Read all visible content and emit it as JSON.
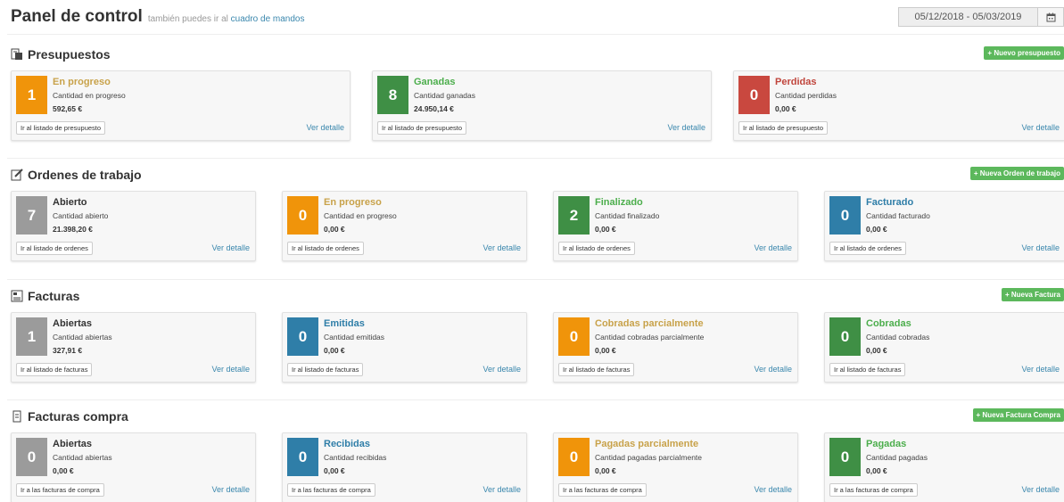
{
  "header": {
    "title": "Panel de control",
    "subtitle": "también puedes ir al",
    "subtitle_link": "cuadro de mandos",
    "date_range": "05/12/2018 - 05/03/2019"
  },
  "colors": {
    "orange": "#f0940a",
    "green": "#3f8f45",
    "red": "#c9483f",
    "gray": "#9b9b9b",
    "blue": "#2f7ea8",
    "title_orange": "#c8a24a",
    "title_green": "#4cae4c",
    "title_red": "#c0453c",
    "title_blue": "#2f7ea8",
    "title_dark": "#333333",
    "button_green": "#5cb85c"
  },
  "sections": [
    {
      "title": "Presupuestos",
      "icon": "quote-icon",
      "new_label": "+ Nuevo presupuesto",
      "cards": [
        {
          "number": "1",
          "title": "En progreso",
          "label": "Cantidad en progreso",
          "amount": "592,65 €",
          "list_label": "Ir al listado de presupuesto",
          "detail_label": "Ver detalle"
        },
        {
          "number": "8",
          "title": "Ganadas",
          "label": "Cantidad ganadas",
          "amount": "24.950,14 €",
          "list_label": "Ir al listado de presupuesto",
          "detail_label": "Ver detalle"
        },
        {
          "number": "0",
          "title": "Perdidas",
          "label": "Cantidad perdidas",
          "amount": "0,00 €",
          "list_label": "Ir al listado de presupuesto",
          "detail_label": "Ver detalle"
        }
      ]
    },
    {
      "title": "Ordenes de trabajo",
      "icon": "edit-icon",
      "new_label": "+ Nueva Orden de trabajo",
      "cards": [
        {
          "number": "7",
          "title": "Abierto",
          "label": "Cantidad abierto",
          "amount": "21.398,20 €",
          "list_label": "Ir al listado de ordenes",
          "detail_label": "Ver detalle"
        },
        {
          "number": "0",
          "title": "En progreso",
          "label": "Cantidad en progreso",
          "amount": "0,00 €",
          "list_label": "Ir al listado de ordenes",
          "detail_label": "Ver detalle"
        },
        {
          "number": "2",
          "title": "Finalizado",
          "label": "Cantidad finalizado",
          "amount": "0,00 €",
          "list_label": "Ir al listado de ordenes",
          "detail_label": "Ver detalle"
        },
        {
          "number": "0",
          "title": "Facturado",
          "label": "Cantidad facturado",
          "amount": "0,00 €",
          "list_label": "Ir al listado de ordenes",
          "detail_label": "Ver detalle"
        }
      ]
    },
    {
      "title": "Facturas",
      "icon": "invoice-icon",
      "new_label": "+ Nueva Factura",
      "cards": [
        {
          "number": "1",
          "title": "Abiertas",
          "label": "Cantidad abiertas",
          "amount": "327,91 €",
          "list_label": "Ir al listado de facturas",
          "detail_label": "Ver detalle"
        },
        {
          "number": "0",
          "title": "Emitidas",
          "label": "Cantidad emitidas",
          "amount": "0,00 €",
          "list_label": "Ir al listado de facturas",
          "detail_label": "Ver detalle"
        },
        {
          "number": "0",
          "title": "Cobradas parcialmente",
          "label": "Cantidad cobradas parcialmente",
          "amount": "0,00 €",
          "list_label": "Ir al listado de facturas",
          "detail_label": "Ver detalle"
        },
        {
          "number": "0",
          "title": "Cobradas",
          "label": "Cantidad cobradas",
          "amount": "0,00 €",
          "list_label": "Ir al listado de facturas",
          "detail_label": "Ver detalle"
        }
      ]
    },
    {
      "title": "Facturas compra",
      "icon": "receipt-icon",
      "new_label": "+ Nueva Factura Compra",
      "cards": [
        {
          "number": "0",
          "title": "Abiertas",
          "label": "Cantidad abiertas",
          "amount": "0,00 €",
          "list_label": "Ir a las facturas de compra",
          "detail_label": "Ver detalle"
        },
        {
          "number": "0",
          "title": "Recibidas",
          "label": "Cantidad recibidas",
          "amount": "0,00 €",
          "list_label": "Ir a las facturas de compra",
          "detail_label": "Ver detalle"
        },
        {
          "number": "0",
          "title": "Pagadas parcialmente",
          "label": "Cantidad pagadas parcialmente",
          "amount": "0,00 €",
          "list_label": "Ir a las facturas de compra",
          "detail_label": "Ver detalle"
        },
        {
          "number": "0",
          "title": "Pagadas",
          "label": "Cantidad pagadas",
          "amount": "0,00 €",
          "list_label": "Ir a las facturas de compra",
          "detail_label": "Ver detalle"
        }
      ]
    }
  ]
}
